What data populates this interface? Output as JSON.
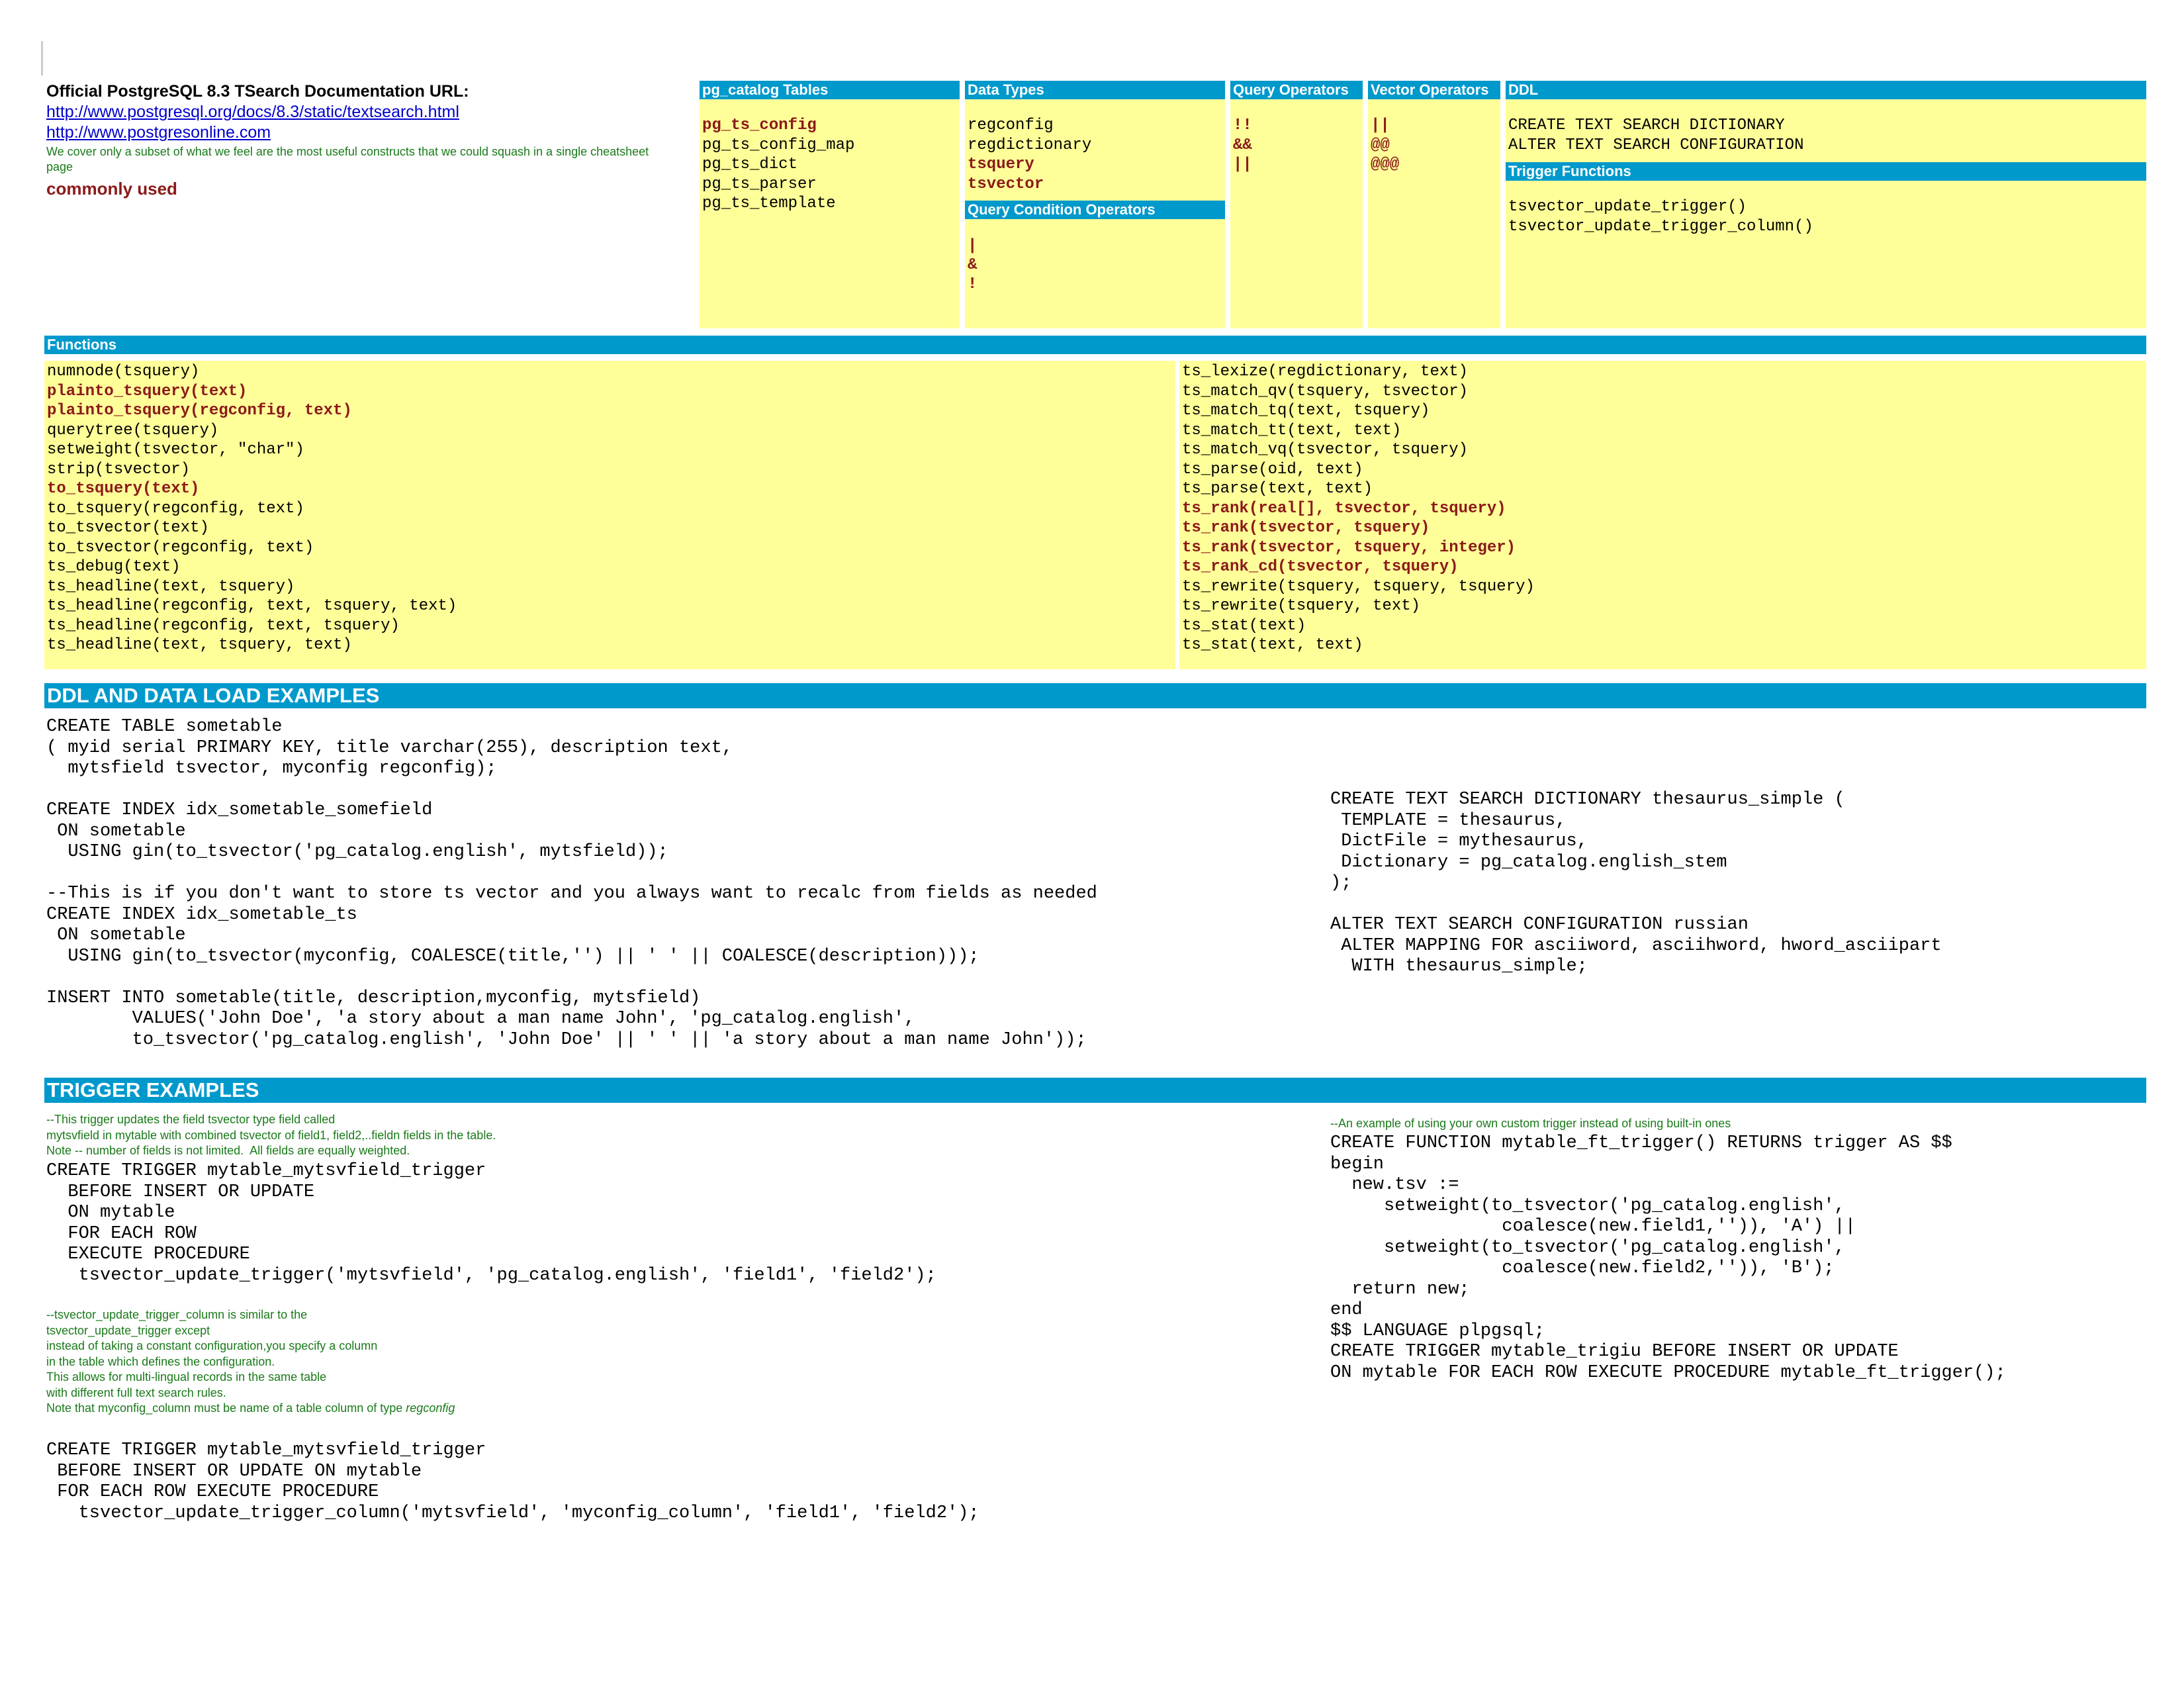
{
  "header": {
    "title": "Official PostgreSQL 8.3 TSearch Documentation URL:",
    "links": [
      "http://www.postgresql.org/docs/8.3/static/textsearch.html",
      "http://www.postgresonline.com"
    ],
    "note": "We cover only a subset of what we feel are the most useful constructs that we could squash in a single cheatsheet page",
    "legend": "commonly used"
  },
  "pg_catalog": {
    "title": "pg_catalog Tables",
    "items": [
      {
        "text": "pg_ts_config",
        "common": true
      },
      {
        "text": "pg_ts_config_map",
        "common": false
      },
      {
        "text": "pg_ts_dict",
        "common": false
      },
      {
        "text": "pg_ts_parser",
        "common": false
      },
      {
        "text": "pg_ts_template",
        "common": false
      }
    ]
  },
  "data_types": {
    "title": "Data Types",
    "items": [
      {
        "text": "regconfig",
        "common": false
      },
      {
        "text": "regdictionary",
        "common": false
      },
      {
        "text": "tsquery",
        "common": true
      },
      {
        "text": "tsvector",
        "common": true
      }
    ]
  },
  "query_condition_operators": {
    "title": "Query Condition Operators",
    "items": [
      "|",
      "&",
      "!"
    ]
  },
  "query_operators": {
    "title": "Query Operators",
    "items": [
      "!!",
      "&&",
      "||"
    ]
  },
  "vector_operators": {
    "title": "Vector Operators",
    "items": [
      "||",
      "@@",
      "@@@"
    ]
  },
  "ddl": {
    "title": "DDL",
    "items": [
      "CREATE TEXT SEARCH DICTIONARY",
      "ALTER TEXT SEARCH CONFIGURATION"
    ]
  },
  "trigger_functions": {
    "title": "Trigger Functions",
    "items": [
      "tsvector_update_trigger()",
      "tsvector_update_trigger_column()"
    ]
  },
  "functions": {
    "title": "Functions",
    "left": [
      {
        "text": "numnode(tsquery)",
        "common": false
      },
      {
        "text": "plainto_tsquery(text)",
        "common": true
      },
      {
        "text": "plainto_tsquery(regconfig, text)",
        "common": true
      },
      {
        "text": "querytree(tsquery)",
        "common": false
      },
      {
        "text": "setweight(tsvector, \"char\")",
        "common": false
      },
      {
        "text": "strip(tsvector)",
        "common": false
      },
      {
        "text": "to_tsquery(text)",
        "common": true
      },
      {
        "text": "to_tsquery(regconfig, text)",
        "common": false
      },
      {
        "text": "to_tsvector(text)",
        "common": false
      },
      {
        "text": "to_tsvector(regconfig, text)",
        "common": false
      },
      {
        "text": "ts_debug(text)",
        "common": false
      },
      {
        "text": "ts_headline(text, tsquery)",
        "common": false
      },
      {
        "text": "ts_headline(regconfig, text, tsquery, text)",
        "common": false
      },
      {
        "text": "ts_headline(regconfig, text, tsquery)",
        "common": false
      },
      {
        "text": "ts_headline(text, tsquery, text)",
        "common": false
      }
    ],
    "right": [
      {
        "text": "ts_lexize(regdictionary, text)",
        "common": false
      },
      {
        "text": "ts_match_qv(tsquery, tsvector)",
        "common": false
      },
      {
        "text": "ts_match_tq(text, tsquery)",
        "common": false
      },
      {
        "text": "ts_match_tt(text, text)",
        "common": false
      },
      {
        "text": "ts_match_vq(tsvector, tsquery)",
        "common": false
      },
      {
        "text": "ts_parse(oid, text)",
        "common": false
      },
      {
        "text": "ts_parse(text, text)",
        "common": false
      },
      {
        "text": "ts_rank(real[], tsvector, tsquery)",
        "common": true
      },
      {
        "text": "ts_rank(tsvector, tsquery)",
        "common": true
      },
      {
        "text": "ts_rank(tsvector, tsquery, integer)",
        "common": true
      },
      {
        "text": "ts_rank_cd(tsvector, tsquery)",
        "common": true
      },
      {
        "text": "ts_rewrite(tsquery, tsquery, tsquery)",
        "common": false
      },
      {
        "text": "ts_rewrite(tsquery, text)",
        "common": false
      },
      {
        "text": "ts_stat(text)",
        "common": false
      },
      {
        "text": "ts_stat(text, text)",
        "common": false
      }
    ]
  },
  "ddl_examples": {
    "title": "DDL AND DATA LOAD EXAMPLES",
    "left_code": "CREATE TABLE sometable\n( myid serial PRIMARY KEY, title varchar(255), description text,\n  mytsfield tsvector, myconfig regconfig);\n\nCREATE INDEX idx_sometable_somefield\n ON sometable\n  USING gin(to_tsvector('pg_catalog.english', mytsfield));\n\n--This is if you don't want to store ts vector and you always want to recalc from fields as needed\nCREATE INDEX idx_sometable_ts\n ON sometable\n  USING gin(to_tsvector(myconfig, COALESCE(title,'') || ' ' || COALESCE(description)));\n\nINSERT INTO sometable(title, description,myconfig, mytsfield)\n        VALUES('John Doe', 'a story about a man name John', 'pg_catalog.english',\n        to_tsvector('pg_catalog.english', 'John Doe' || ' ' || 'a story about a man name John'));",
    "right_code": "CREATE TEXT SEARCH DICTIONARY thesaurus_simple (\n TEMPLATE = thesaurus,\n DictFile = mythesaurus,\n Dictionary = pg_catalog.english_stem\n);\n\nALTER TEXT SEARCH CONFIGURATION russian\n ALTER MAPPING FOR asciiword, asciihword, hword_asciipart\n  WITH thesaurus_simple;"
  },
  "trigger_examples": {
    "title": "TRIGGER EXAMPLES",
    "comment1": "--This trigger updates the field tsvector type field called\nmytsvfield in mytable with combined tsvector of field1, field2,..fieldn fields in the table.\nNote -- number of fields is not limited.  All fields are equally weighted.",
    "code1": "CREATE TRIGGER mytable_mytsvfield_trigger\n  BEFORE INSERT OR UPDATE\n  ON mytable\n  FOR EACH ROW\n  EXECUTE PROCEDURE\n   tsvector_update_trigger('mytsvfield', 'pg_catalog.english', 'field1', 'field2');",
    "comment2": "--tsvector_update_trigger_column is similar to the\ntsvector_update_trigger except\ninstead of taking a constant configuration,you specify a column\nin the table which defines the configuration.\nThis allows for multi-lingual records in the same table\nwith different full text search rules.",
    "comment2_last": "Note that myconfig_column must be name of a table column of type ",
    "comment2_last_em": "regconfig",
    "code2": "CREATE TRIGGER mytable_mytsvfield_trigger\n BEFORE INSERT OR UPDATE ON mytable\n FOR EACH ROW EXECUTE PROCEDURE\n   tsvector_update_trigger_column('mytsvfield', 'myconfig_column', 'field1', 'field2');",
    "comment3": "--An example of using your own custom trigger instead of using built-in ones",
    "code3": "CREATE FUNCTION mytable_ft_trigger() RETURNS trigger AS $$\nbegin\n  new.tsv :=\n     setweight(to_tsvector('pg_catalog.english',\n                coalesce(new.field1,'')), 'A') ||\n     setweight(to_tsvector('pg_catalog.english',\n                coalesce(new.field2,'')), 'B');\n  return new;\nend\n$$ LANGUAGE plpgsql;\nCREATE TRIGGER mytable_trigiu BEFORE INSERT OR UPDATE\nON mytable FOR EACH ROW EXECUTE PROCEDURE mytable_ft_trigger();"
  },
  "colors": {
    "header_bar": "#0099cc",
    "box_fill": "#ffff99",
    "common_text": "#8b1a1a",
    "comment_text": "#1a7a1a",
    "link": "#0000cc"
  }
}
